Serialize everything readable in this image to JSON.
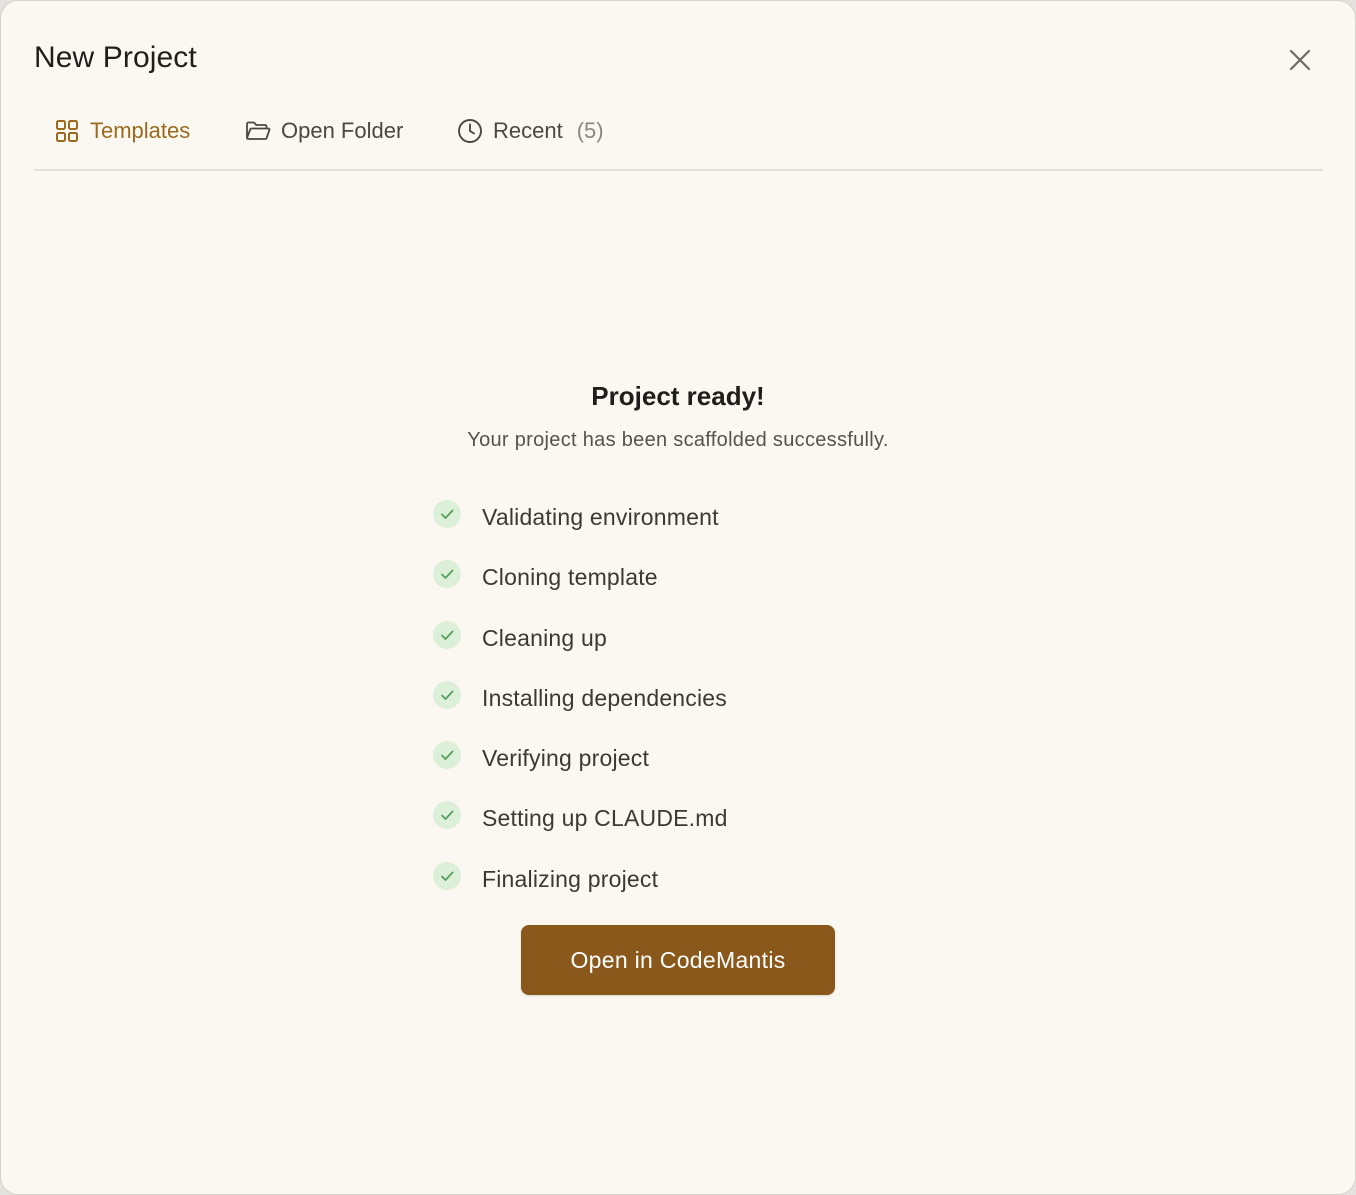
{
  "dialog": {
    "title": "New Project",
    "close_icon": "close-icon"
  },
  "tabs": [
    {
      "label": "Templates",
      "icon": "grid-icon",
      "active": true,
      "count": ""
    },
    {
      "label": "Open Folder",
      "icon": "folder-open-icon",
      "active": false,
      "count": ""
    },
    {
      "label": "Recent",
      "icon": "clock-icon",
      "active": false,
      "count": "(5)"
    }
  ],
  "result": {
    "heading": "Project ready!",
    "subheading": "Your project has been scaffolded successfully.",
    "steps": [
      {
        "label": "Validating environment",
        "status": "done"
      },
      {
        "label": "Cloning template",
        "status": "done"
      },
      {
        "label": "Cleaning up",
        "status": "done"
      },
      {
        "label": "Installing dependencies",
        "status": "done"
      },
      {
        "label": "Verifying project",
        "status": "done"
      },
      {
        "label": "Setting up CLAUDE.md",
        "status": "done"
      },
      {
        "label": "Finalizing project",
        "status": "done"
      }
    ],
    "primary_button": "Open in CodeMantis"
  },
  "colors": {
    "background": "#fbf7f1",
    "accent": "#9b6a1f",
    "button": "#8b581b",
    "success_bg": "#dcefd8",
    "success_check": "#57a05a"
  }
}
